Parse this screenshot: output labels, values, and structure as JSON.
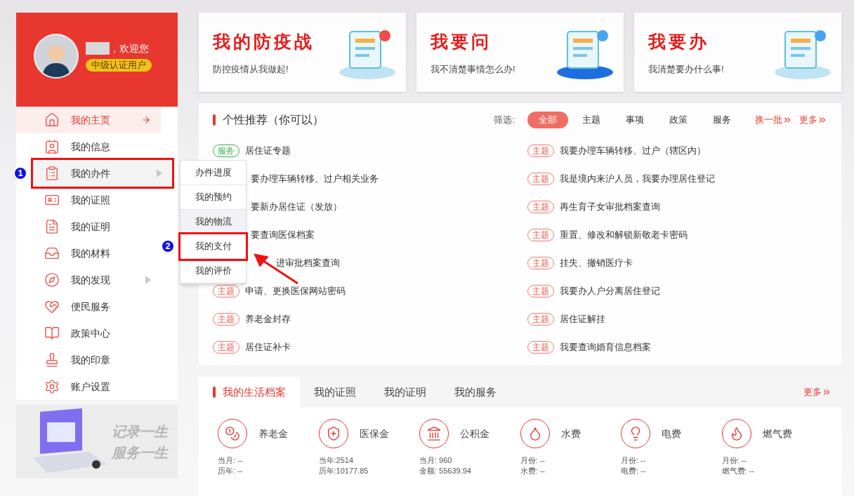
{
  "user": {
    "greeting": "，欢迎您",
    "level": "中级认证用户"
  },
  "menu": [
    {
      "label": "我的主页",
      "selected": true,
      "submenu": false,
      "expanded": false
    },
    {
      "label": "我的信息",
      "selected": false,
      "submenu": false,
      "expanded": false
    },
    {
      "label": "我的办件",
      "selected": false,
      "submenu": true,
      "expanded": true,
      "callout": "1"
    },
    {
      "label": "我的证照",
      "selected": false,
      "submenu": false,
      "expanded": false
    },
    {
      "label": "我的证明",
      "selected": false,
      "submenu": false,
      "expanded": false
    },
    {
      "label": "我的材料",
      "selected": false,
      "submenu": false,
      "expanded": false
    },
    {
      "label": "我的发现",
      "selected": false,
      "submenu": true,
      "expanded": false
    },
    {
      "label": "便民服务",
      "selected": false,
      "submenu": false,
      "expanded": false
    },
    {
      "label": "政策中心",
      "selected": false,
      "submenu": false,
      "expanded": false
    },
    {
      "label": "我的印章",
      "selected": false,
      "submenu": false,
      "expanded": false
    },
    {
      "label": "账户设置",
      "selected": false,
      "submenu": false,
      "expanded": false
    }
  ],
  "submenu": [
    {
      "label": "办件进度",
      "selected": false
    },
    {
      "label": "我的预约",
      "selected": false
    },
    {
      "label": "我的物流",
      "selected": true
    },
    {
      "label": "我的支付",
      "selected": false,
      "callout": "2"
    },
    {
      "label": "我的评价",
      "selected": false
    }
  ],
  "banner": {
    "line_1": "记录一生",
    "line_2": "服务一生"
  },
  "cards": [
    {
      "title": "我的防疫战",
      "subtitle": "防控疫情从我做起!"
    },
    {
      "title": "我要问",
      "subtitle": "我不清楚事情怎么办!"
    },
    {
      "title": "我要办",
      "subtitle": "我清楚要办什么事!"
    }
  ],
  "recommend": {
    "title": "个性推荐（你可以）",
    "filter_label": "筛选:",
    "filters": [
      {
        "label": "全部",
        "selected": true
      },
      {
        "label": "主题",
        "selected": false
      },
      {
        "label": "事项",
        "selected": false
      },
      {
        "label": "政策",
        "selected": false
      },
      {
        "label": "服务",
        "selected": false
      }
    ],
    "refresh": "换一批",
    "more": "更多",
    "left": [
      {
        "tag": "服务",
        "kind": "service",
        "text": "居住证专题"
      },
      {
        "text": "要办理车辆转移、过户相关业务"
      },
      {
        "text": "要新办居住证（发放）"
      },
      {
        "text": "要查询医保档案"
      },
      {
        "text": "进审批档案查询",
        "kind": "arrow_gap"
      },
      {
        "tag": "主题",
        "kind": "topic",
        "text": "申请、更换医保网站密码"
      },
      {
        "tag": "主题",
        "kind": "topic",
        "text": "养老金封存"
      },
      {
        "tag": "主题",
        "kind": "topic",
        "text": "居住证补卡"
      }
    ],
    "right": [
      {
        "tag": "主题",
        "kind": "topic",
        "text": "我要办理车辆转移、过户（辖区内）"
      },
      {
        "tag": "主题",
        "kind": "topic",
        "text": "我是境内来沪人员，我要办理居住登记"
      },
      {
        "tag": "主题",
        "kind": "topic",
        "text": "再生育子女审批档案查询"
      },
      {
        "tag": "主题",
        "kind": "topic",
        "text": "重置、修改和解锁新敬老卡密码"
      },
      {
        "tag": "主题",
        "kind": "topic",
        "text": "挂失、撤销医疗卡"
      },
      {
        "tag": "主题",
        "kind": "topic",
        "text": "我要办人户分离居住登记"
      },
      {
        "tag": "主题",
        "kind": "topic",
        "text": "居住证解挂"
      },
      {
        "tag": "主题",
        "kind": "topic",
        "text": "我要查询婚育信息档案"
      }
    ]
  },
  "archive": {
    "tabs": [
      {
        "label": "我的生活档案",
        "selected": true
      },
      {
        "label": "我的证照",
        "selected": false
      },
      {
        "label": "我的证明",
        "selected": false
      },
      {
        "label": "我的服务",
        "selected": false
      }
    ],
    "more": "更多",
    "items": [
      {
        "kind": "pension",
        "label": "养老金",
        "line_1": "当月: --",
        "line_2": "历年: --"
      },
      {
        "kind": "medical",
        "label": "医保金",
        "line_1": "当年:2514",
        "line_2": "历年:10177.85"
      },
      {
        "kind": "fund",
        "label": "公积金",
        "line_1": "当月: 960",
        "line_2": "金额: 55639.94"
      },
      {
        "kind": "water",
        "label": "水费",
        "line_1": "月份: --",
        "line_2": "水费: --"
      },
      {
        "kind": "power",
        "label": "电费",
        "line_1": "月份: --",
        "line_2": "电费: --"
      },
      {
        "kind": "gas",
        "label": "燃气费",
        "line_1": "月份: --",
        "line_2": "燃气费: --"
      }
    ]
  }
}
